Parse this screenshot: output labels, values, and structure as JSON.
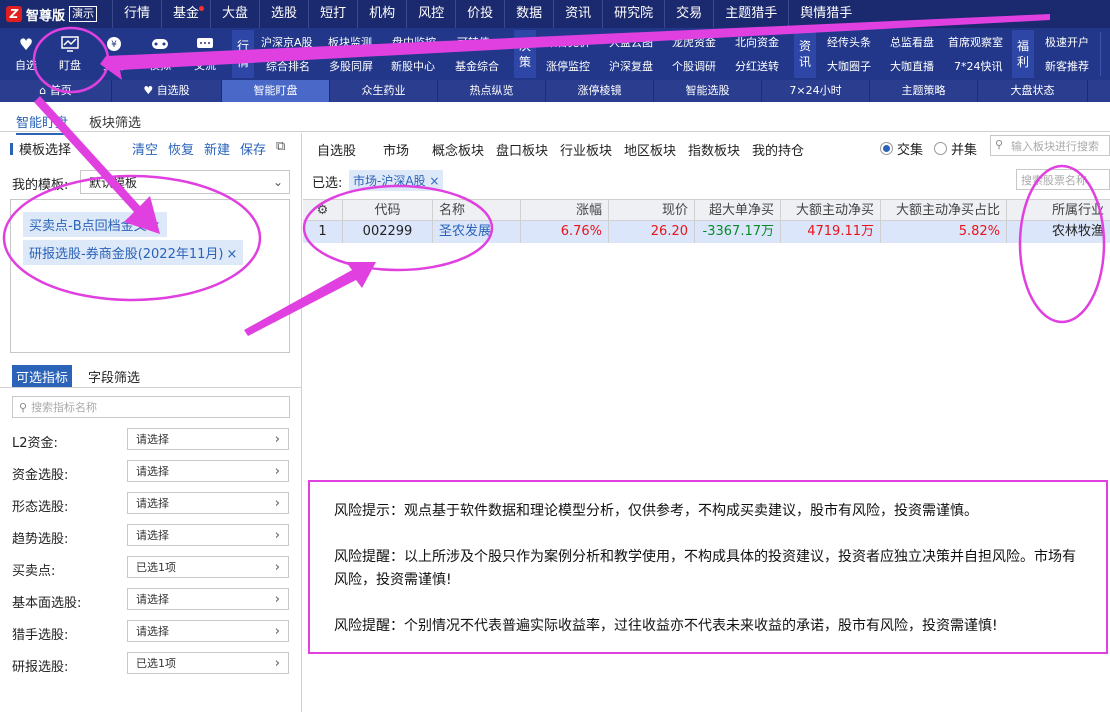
{
  "menubar": {
    "logo_text": "智尊版",
    "demo_badge": "演示",
    "items": [
      "行情",
      "基金",
      "大盘",
      "选股",
      "短打",
      "机构",
      "风控",
      "价投",
      "数据",
      "资讯",
      "研究院",
      "交易",
      "主题猎手",
      "舆情猎手"
    ]
  },
  "toolbar": {
    "big_buttons": [
      {
        "label": "自选",
        "icon": "heart-icon"
      },
      {
        "label": "盯盘",
        "icon": "chart-monitor-icon"
      },
      {
        "label": "交易",
        "icon": "trade-icon"
      },
      {
        "label": "模拟",
        "icon": "gamepad-icon"
      },
      {
        "label": "交流",
        "icon": "chat-icon"
      }
    ],
    "group_hangqing": {
      "title": "行情",
      "top": [
        "沪深京A股",
        "板块监测",
        "盘中监控",
        "可转债"
      ],
      "bottom": [
        "综合排名",
        "多股同屏",
        "新股中心",
        "基金综合"
      ]
    },
    "group_juece": {
      "title": "决策",
      "top": [
        "集合竞价",
        "大盘云图",
        "龙虎资金",
        "北向资金"
      ],
      "bottom": [
        "涨停监控",
        "沪深复盘",
        "个股调研",
        "分红送转"
      ]
    },
    "group_zixun": {
      "title": "资讯",
      "top": [
        "经传头条",
        "总监看盘",
        "首席观察室"
      ],
      "bottom": [
        "大咖圈子",
        "大咖直播",
        "7*24快讯"
      ]
    },
    "group_fuli": {
      "title": "福利",
      "top": [
        "极速开户"
      ],
      "bottom": [
        "新客推荐"
      ]
    }
  },
  "navbar": {
    "tabs": [
      "首页",
      "自选股",
      "智能盯盘",
      "众生药业",
      "热点纵览",
      "涨停棱镜",
      "智能选股",
      "7×24小时",
      "主题策略",
      "大盘状态"
    ],
    "active_index": 2
  },
  "subtabs": [
    "智能盯盘",
    "板块筛选"
  ],
  "left": {
    "template_header": "模板选择",
    "actions": [
      "清空",
      "恢复",
      "新建",
      "保存"
    ],
    "my_template_label": "我的模板:",
    "my_template_value": "默认模板",
    "chips": [
      "买卖点-B点回档金叉",
      "研报选股-券商金股(2022年11月)"
    ],
    "indicator_tabs": [
      "可选指标",
      "字段筛选"
    ],
    "indicator_search_placeholder": "搜索指标名称",
    "filters": [
      {
        "label": "L2资金:",
        "value": "请选择"
      },
      {
        "label": "资金选股:",
        "value": "请选择"
      },
      {
        "label": "形态选股:",
        "value": "请选择"
      },
      {
        "label": "趋势选股:",
        "value": "请选择"
      },
      {
        "label": "买卖点:",
        "value": "已选1项"
      },
      {
        "label": "基本面选股:",
        "value": "请选择"
      },
      {
        "label": "猎手选股:",
        "value": "请选择"
      },
      {
        "label": "研报选股:",
        "value": "已选1项"
      }
    ]
  },
  "right": {
    "category_tabs": [
      "自选股",
      "市场",
      "概念板块",
      "盘口板块",
      "行业板块",
      "地区板块",
      "指数板块",
      "我的持仓"
    ],
    "radio_intersection": "交集",
    "radio_union": "并集",
    "block_search_placeholder": "输入板块进行搜索",
    "selected_label": "已选:",
    "selected_chip": "市场-沪深A股",
    "stock_search_placeholder": "搜索股票名称",
    "columns": [
      "",
      "代码",
      "名称",
      "涨幅",
      "现价",
      "超大单净买",
      "大额主动净买",
      "大额主动净买占比",
      "所属行业"
    ],
    "rows": [
      {
        "index": "1",
        "code": "002299",
        "name": "圣农发展",
        "change": "6.76%",
        "price": "26.20",
        "super_large_net": "-3367.17万",
        "large_active_net": "4719.11万",
        "large_active_ratio": "5.82%",
        "industry": "农林牧渔"
      }
    ]
  },
  "disclaimer": {
    "p1": "风险提示：观点基于软件数据和理论模型分析，仅供参考，不构成买卖建议，股市有风险，投资需谨慎。",
    "p2": "风险提醒：以上所涉及个股只作为案例分析和教学使用，不构成具体的投资建议，投资者应独立决策并自担风险。市场有风险，投资需谨慎!",
    "p3": "风险提醒：个别情况不代表普遍实际收益率，过往收益亦不代表未来收益的承诺，股市有风险，投资需谨慎!"
  },
  "colors": {
    "menubar": "#1b2a6e",
    "toolbar": "#22378a",
    "accent": "#2a63b8",
    "up": "#e8141a",
    "down": "#0a8a2a",
    "annotation": "#e040e0"
  }
}
